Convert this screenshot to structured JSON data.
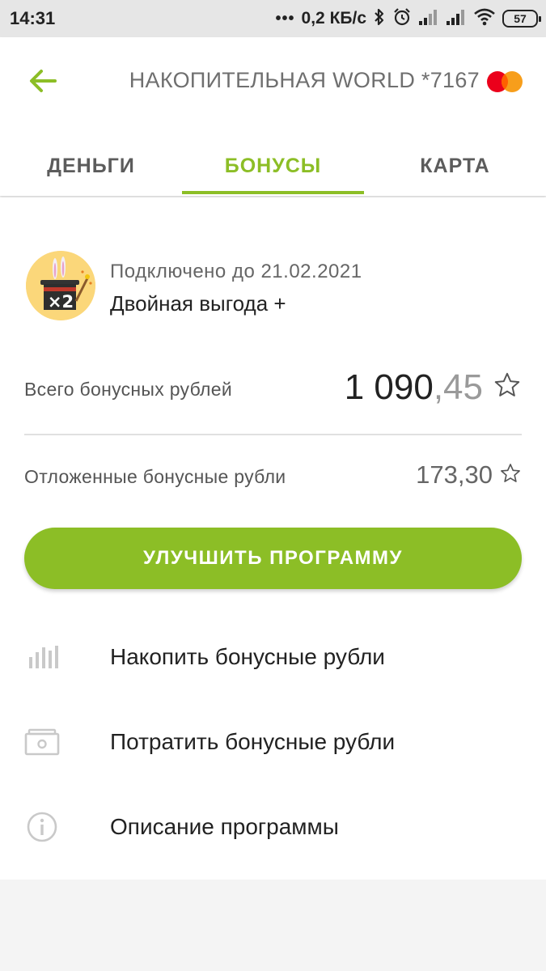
{
  "status_bar": {
    "time": "14:31",
    "dots": "•••",
    "speed": "0,2 КБ/с",
    "battery": "57"
  },
  "header": {
    "card_title": "НАКОПИТЕЛЬНАЯ WORLD *7167"
  },
  "tabs": [
    {
      "label": "ДЕНЬГИ",
      "active": false
    },
    {
      "label": "БОНУСЫ",
      "active": true
    },
    {
      "label": "КАРТА",
      "active": false
    }
  ],
  "program": {
    "connected_until": "Подключено до 21.02.2021",
    "name": "Двойная выгода +",
    "badge_text": "×2"
  },
  "bonuses": {
    "total_label": "Всего бонусных рублей",
    "total_whole": "1 090",
    "total_cents": ",45",
    "deferred_label": "Отложенные бонусные рубли",
    "deferred_amount": "173,30"
  },
  "upgrade_button": "УЛУЧШИТЬ ПРОГРАММУ",
  "menu": [
    {
      "label": "Накопить бонусные рубли",
      "icon": "bars-chart-icon"
    },
    {
      "label": "Потратить бонусные рубли",
      "icon": "wallet-icon"
    },
    {
      "label": "Описание программы",
      "icon": "info-icon"
    }
  ],
  "colors": {
    "accent": "#8cbe26",
    "status_bar_bg": "#e6e6e6",
    "mastercard_red": "#eb001b",
    "mastercard_orange": "#f79e1b"
  }
}
